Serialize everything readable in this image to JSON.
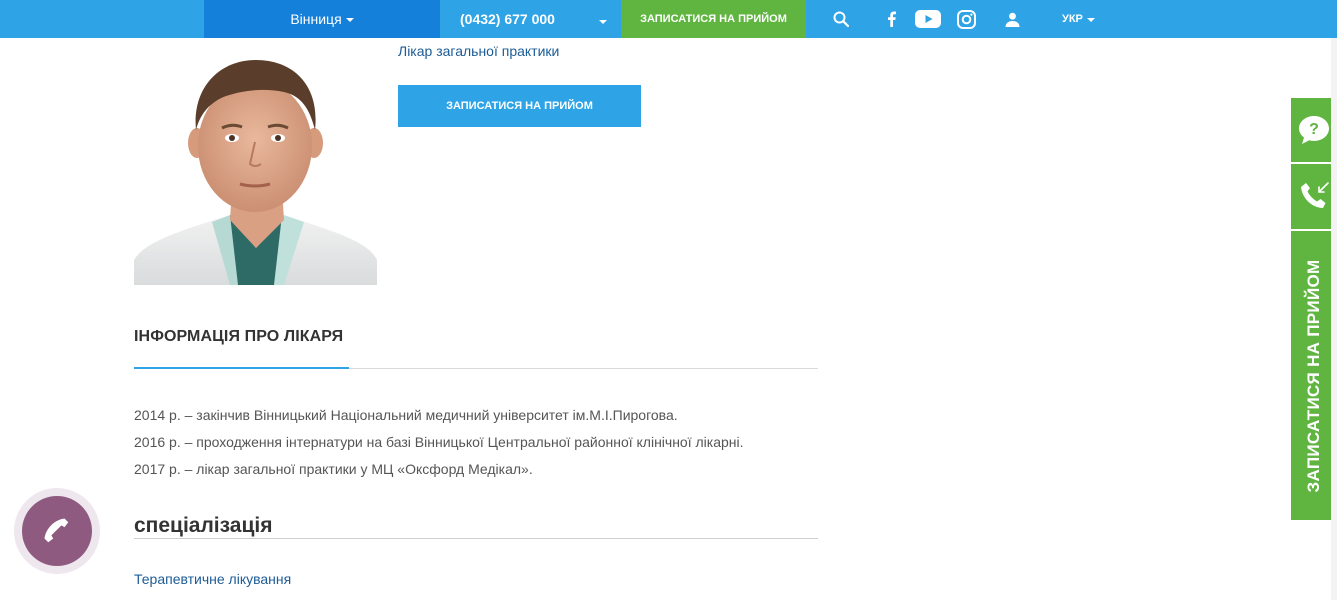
{
  "header": {
    "city": "Вінниця",
    "phone": "(0432) 677 000",
    "book_label": "ЗАПИСАТИСЯ НА ПРИЙОМ",
    "lang": "УКР"
  },
  "doctor": {
    "specialty": "Лікар загальної практики",
    "book_label": "ЗАПИСАТИСЯ НА ПРИЙОМ"
  },
  "info": {
    "title": "ІНФОРМАЦІЯ ПРО ЛІКАРЯ",
    "lines": [
      "2014 р. – закінчив Вінницький Національний медичний університет ім.М.І.Пирогова.",
      "2016 р. – проходження інтернатури на базі Вінницької Центральної районної клінічної лікарні.",
      "2017 р. – лікар загальної практики у МЦ «Оксфорд Медікал»."
    ]
  },
  "specialization": {
    "title": "спеціалізація",
    "items": [
      "Терапевтичне лікування"
    ]
  },
  "sidebar": {
    "book_label": "ЗАПИСАТИСЯ НА ПРИЙОМ"
  },
  "icons": {
    "search": "search-icon",
    "facebook": "facebook-icon",
    "youtube": "youtube-icon",
    "instagram": "instagram-icon",
    "user": "user-icon",
    "question": "question-chat-icon",
    "callback": "callback-phone-icon",
    "call": "phone-icon"
  },
  "colors": {
    "topbar": "#2ea3e6",
    "city_bg": "#1480d9",
    "green": "#5fb540",
    "link": "#1d5c96",
    "call_float": "#8e5a80"
  }
}
